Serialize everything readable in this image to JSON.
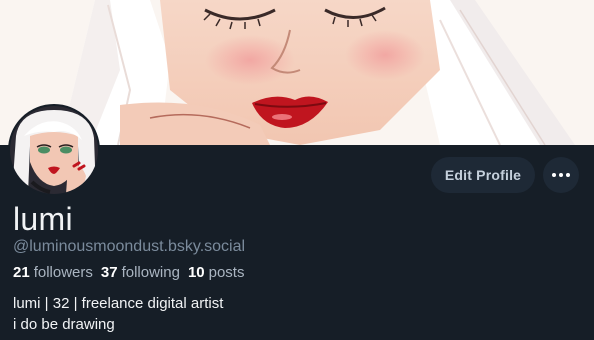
{
  "profile": {
    "display_name": "lumi",
    "handle": "@luminousmoondust.bsky.social",
    "bio_lines": [
      "lumi | 32 | freelance digital artist",
      "i do be drawing"
    ]
  },
  "stats": {
    "followers_count": "21",
    "followers_label": "followers",
    "following_count": "37",
    "following_label": "following",
    "posts_count": "10",
    "posts_label": "posts"
  },
  "actions": {
    "edit_profile_label": "Edit Profile",
    "more_icon": "ellipsis-icon"
  },
  "colors": {
    "background": "#161e27",
    "button_bg": "#1e2936",
    "handle_text": "#7b8b9c"
  }
}
